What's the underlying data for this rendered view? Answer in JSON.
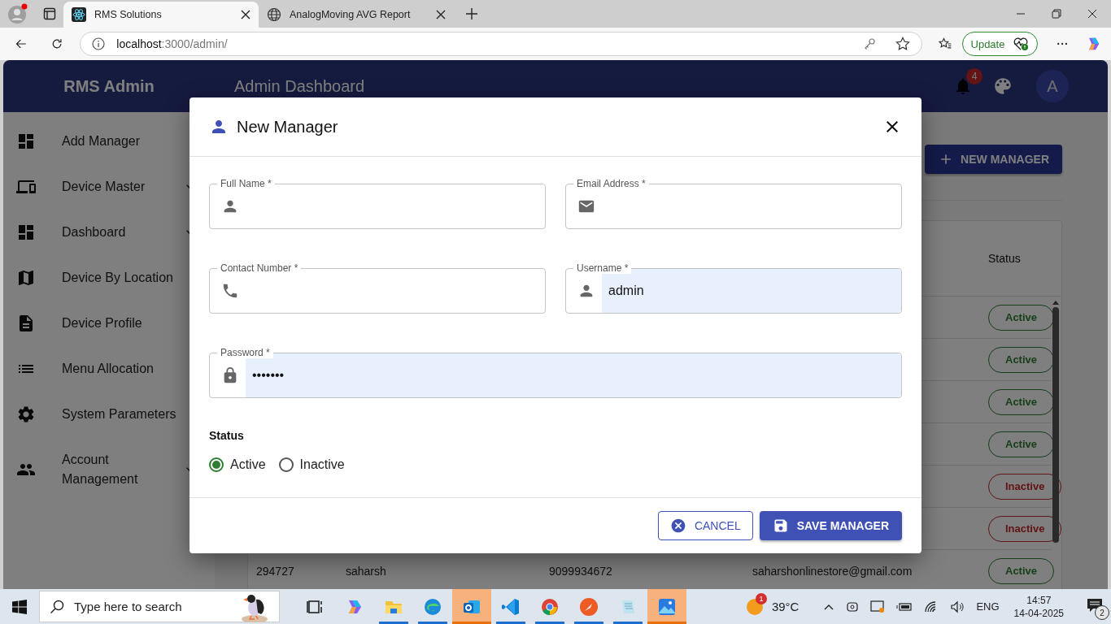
{
  "browser": {
    "tabs": [
      {
        "title": "RMS Solutions",
        "selected": true
      },
      {
        "title": "AnalogMoving AVG Report",
        "selected": false
      }
    ],
    "url": {
      "host": "localhost",
      "path": ":3000/admin/"
    },
    "update_button": "Update"
  },
  "app": {
    "brand": "RMS Admin",
    "page_title": "Admin Dashboard",
    "notification_count": "4",
    "avatar": "A",
    "sidebar": {
      "items": [
        {
          "label": "Add Manager",
          "has_submenu": false
        },
        {
          "label": "Device Master",
          "has_submenu": true
        },
        {
          "label": "Dashboard",
          "has_submenu": true
        },
        {
          "label": "Device By Location",
          "has_submenu": false
        },
        {
          "label": "Device Profile",
          "has_submenu": false
        },
        {
          "label": "Menu Allocation",
          "has_submenu": false
        },
        {
          "label": "System Parameters",
          "has_submenu": false
        },
        {
          "label": "Account Management",
          "has_submenu": true
        }
      ]
    },
    "new_manager_button": "NEW MANAGER",
    "table": {
      "status_header": "Status",
      "rows": [
        {
          "status": "Active",
          "kind": "active"
        },
        {
          "status": "Active",
          "kind": "active"
        },
        {
          "status": "Active",
          "kind": "active"
        },
        {
          "status": "Active",
          "kind": "active"
        },
        {
          "status": "Inactive",
          "kind": "inactive"
        },
        {
          "status": "Inactive",
          "kind": "inactive"
        },
        {
          "cells": [
            "294727",
            "saharsh",
            "9099934672",
            "saharshonlinestore@gmail.com"
          ],
          "status": "Active",
          "kind": "active"
        }
      ]
    }
  },
  "dialog": {
    "title": "New Manager",
    "fields": [
      {
        "label": "Full Name *",
        "autofilled": false,
        "wide": false
      },
      {
        "label": "Email Address *",
        "autofilled": false,
        "wide": false
      },
      {
        "label": "Contact Number *",
        "autofilled": false,
        "wide": false
      },
      {
        "label": "Username *",
        "value": "admin",
        "autofilled": true,
        "wide": false
      },
      {
        "label": "Password *",
        "value": "•••••••",
        "autofilled": true,
        "wide": true
      }
    ],
    "status_label": "Status",
    "status_options": [
      {
        "label": "Active",
        "selected": true
      },
      {
        "label": "Inactive",
        "selected": false
      }
    ],
    "cancel_button": "CANCEL",
    "save_button": "SAVE MANAGER"
  },
  "taskbar": {
    "search_placeholder": "Type here to search",
    "apps": [
      {
        "running": false,
        "flashing": false
      },
      {
        "running": false,
        "flashing": false
      },
      {
        "running": true,
        "flashing": false
      },
      {
        "running": true,
        "flashing": false
      },
      {
        "running": true,
        "flashing": true
      },
      {
        "running": true,
        "flashing": false
      },
      {
        "running": true,
        "flashing": false
      },
      {
        "running": true,
        "flashing": false
      },
      {
        "running": true,
        "flashing": false
      },
      {
        "running": true,
        "flashing": true
      }
    ],
    "weather": "39°C",
    "weather_badge": "1",
    "language": "ENG",
    "time": "14:57",
    "date": "14-04-2025",
    "notification_badge": "2"
  }
}
